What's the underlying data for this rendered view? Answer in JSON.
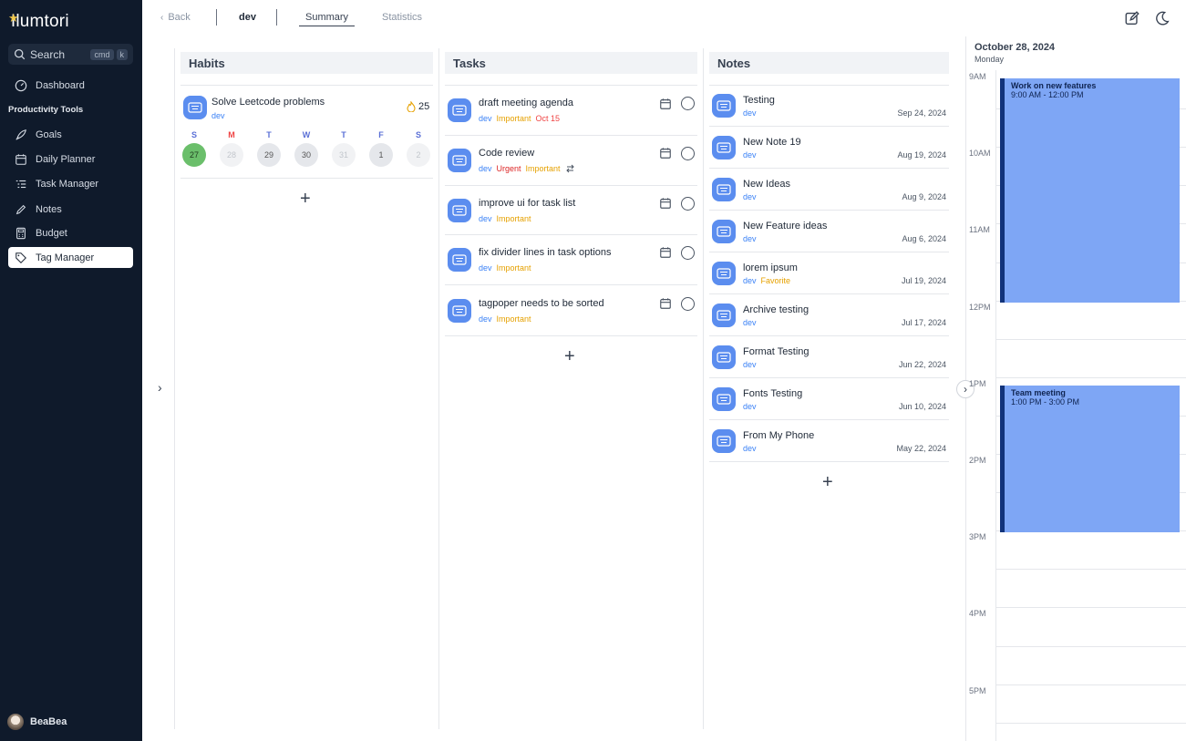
{
  "app": {
    "logo": "Ilumtori"
  },
  "search": {
    "label": "Search",
    "kbd1": "cmd",
    "kbd2": "k"
  },
  "sidebar": {
    "dashboard": "Dashboard",
    "section": "Productivity Tools",
    "items": [
      {
        "label": "Goals",
        "icon": "rocket-icon"
      },
      {
        "label": "Daily Planner",
        "icon": "calendar-icon"
      },
      {
        "label": "Task Manager",
        "icon": "list-icon"
      },
      {
        "label": "Notes",
        "icon": "pencil-icon"
      },
      {
        "label": "Budget",
        "icon": "calculator-icon"
      },
      {
        "label": "Tag Manager",
        "icon": "tag-icon"
      }
    ],
    "user": "BeaBea"
  },
  "topbar": {
    "back": "Back",
    "crumb": "dev",
    "tab_summary": "Summary",
    "tab_statistics": "Statistics"
  },
  "habits": {
    "header": "Habits",
    "item": {
      "title": "Solve Leetcode problems",
      "tag": "dev",
      "streak": "25"
    },
    "days": [
      {
        "name": "S",
        "num": "27"
      },
      {
        "name": "M",
        "num": "28"
      },
      {
        "name": "T",
        "num": "29"
      },
      {
        "name": "W",
        "num": "30"
      },
      {
        "name": "T",
        "num": "31"
      },
      {
        "name": "F",
        "num": "1"
      },
      {
        "name": "S",
        "num": "2"
      }
    ]
  },
  "tasks": {
    "header": "Tasks",
    "items": [
      {
        "title": "draft meeting agenda",
        "tags": [
          "dev",
          "Important"
        ],
        "date": "Oct 15"
      },
      {
        "title": "Code review",
        "tags": [
          "dev",
          "Urgent",
          "Important"
        ]
      },
      {
        "title": "improve ui for task list",
        "tags": [
          "dev",
          "Important"
        ]
      },
      {
        "title": "fix divider lines in task options",
        "tags": [
          "dev",
          "Important"
        ]
      },
      {
        "title": "tagpoper needs to be sorted",
        "tags": [
          "dev",
          "Important"
        ]
      }
    ]
  },
  "notes": {
    "header": "Notes",
    "items": [
      {
        "title": "Testing",
        "tag": "dev",
        "date": "Sep 24, 2024"
      },
      {
        "title": "New Note 19",
        "tag": "dev",
        "date": "Aug 19, 2024"
      },
      {
        "title": "New Ideas",
        "tag": "dev",
        "date": "Aug 9, 2024"
      },
      {
        "title": "New Feature ideas",
        "tag": "dev",
        "date": "Aug 6, 2024"
      },
      {
        "title": "lorem ipsum",
        "tag": "dev",
        "tag2": "Favorite",
        "date": "Jul 19, 2024"
      },
      {
        "title": "Archive testing",
        "tag": "dev",
        "date": "Jul 17, 2024"
      },
      {
        "title": "Format Testing",
        "tag": "dev",
        "date": "Jun 22, 2024"
      },
      {
        "title": "Fonts Testing",
        "tag": "dev",
        "date": "Jun 10, 2024"
      },
      {
        "title": "From My Phone",
        "tag": "dev",
        "date": "May 22, 2024"
      }
    ]
  },
  "calendar": {
    "date": "October 28, 2024",
    "weekday": "Monday",
    "hours": [
      "9AM",
      "10AM",
      "11AM",
      "12PM",
      "1PM",
      "2PM",
      "3PM",
      "4PM",
      "5PM"
    ],
    "events": [
      {
        "title": "Work on new features",
        "time": "9:00 AM - 12:00 PM"
      },
      {
        "title": "Team meeting",
        "time": "1:00 PM - 3:00 PM"
      }
    ]
  },
  "colors": {
    "sidebar": "#0f1a2b",
    "accent": "#5b8def",
    "event": "#7ea6f5"
  }
}
